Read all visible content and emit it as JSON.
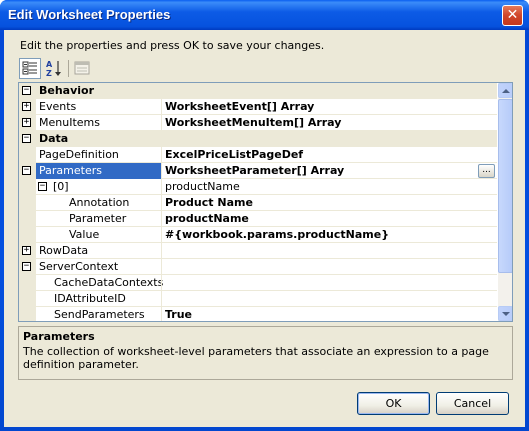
{
  "window": {
    "title": "Edit Worksheet Properties"
  },
  "instructions": "Edit the properties and press OK to save your changes.",
  "toolbar": {
    "categorized_icon": "categorized-icon",
    "alphabetical_icon": "alphabetical-sort-icon",
    "property_pages_icon": "property-pages-icon"
  },
  "grid": {
    "rows": [
      {
        "type": "category",
        "name": "Behavior",
        "expander": "−"
      },
      {
        "type": "prop",
        "name": "Events",
        "value": "WorksheetEvent[] Array",
        "expander": "+",
        "bold": true
      },
      {
        "type": "prop",
        "name": "MenuItems",
        "value": "WorksheetMenuItem[] Array",
        "expander": "+",
        "bold": true
      },
      {
        "type": "category",
        "name": "Data",
        "expander": "−"
      },
      {
        "type": "prop",
        "name": "PageDefinition",
        "value": "ExcelPriceListPageDef",
        "bold": true
      },
      {
        "type": "prop",
        "name": "Parameters",
        "value": "WorksheetParameter[] Array",
        "expander": "−",
        "bold": true,
        "selected": true
      },
      {
        "type": "prop",
        "name": "[0]",
        "value": "productName",
        "expander": "−",
        "indent": 1
      },
      {
        "type": "prop",
        "name": "Annotation",
        "value": "Product Name",
        "indent": 2,
        "bold": true
      },
      {
        "type": "prop",
        "name": "Parameter",
        "value": "productName",
        "indent": 2,
        "bold": true
      },
      {
        "type": "prop",
        "name": "Value",
        "value": "#{workbook.params.productName}",
        "indent": 2,
        "bold": true
      },
      {
        "type": "prop",
        "name": "RowData",
        "value": "",
        "expander": "+"
      },
      {
        "type": "prop",
        "name": "ServerContext",
        "value": "",
        "expander": "−"
      },
      {
        "type": "prop",
        "name": "CacheDataContexts",
        "value": "",
        "indent": 1
      },
      {
        "type": "prop",
        "name": "IDAttributeID",
        "value": "",
        "indent": 1
      },
      {
        "type": "prop",
        "name": "SendParameters",
        "value": "True",
        "indent": 1,
        "bold": true
      }
    ],
    "ellipsis_label": "..."
  },
  "help": {
    "title": "Parameters",
    "description": "The collection of worksheet-level parameters that associate an expression to a page definition parameter."
  },
  "buttons": {
    "ok": "OK",
    "cancel": "Cancel"
  },
  "colors": {
    "selection": "#316ac5",
    "titlebar": "#0652de",
    "dialog_bg": "#ece9d8"
  }
}
